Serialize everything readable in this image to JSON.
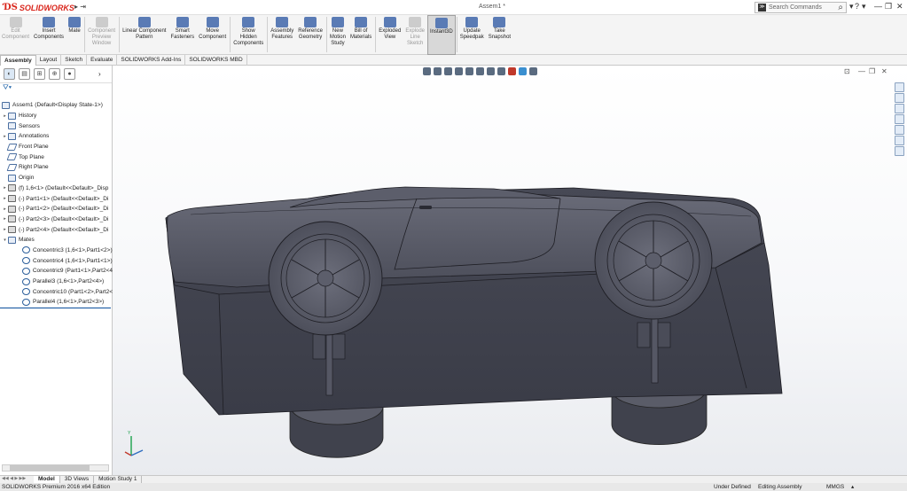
{
  "app": {
    "name": "SOLIDWORKS",
    "window_title": "Assem1 *"
  },
  "search": {
    "placeholder": "Search Commands"
  },
  "ribbon": {
    "buttons": [
      {
        "label": "Edit\nComponent",
        "disabled": true,
        "icon": "edit-component-icon"
      },
      {
        "label": "Insert\nComponents",
        "disabled": false,
        "icon": "insert-components-icon"
      },
      {
        "label": "Mate",
        "disabled": false,
        "icon": "mate-icon"
      },
      {
        "label": "Component\nPreview\nWindow",
        "disabled": true,
        "icon": "component-preview-icon"
      },
      {
        "label": "Linear Component\nPattern",
        "disabled": false,
        "icon": "linear-pattern-icon"
      },
      {
        "label": "Smart\nFasteners",
        "disabled": false,
        "icon": "smart-fasteners-icon"
      },
      {
        "label": "Move\nComponent",
        "disabled": false,
        "icon": "move-component-icon"
      },
      {
        "label": "Show\nHidden\nComponents",
        "disabled": false,
        "icon": "show-hidden-icon"
      },
      {
        "label": "Assembly\nFeatures",
        "disabled": false,
        "icon": "assembly-features-icon"
      },
      {
        "label": "Reference\nGeometry",
        "disabled": false,
        "icon": "reference-geometry-icon"
      },
      {
        "label": "New\nMotion\nStudy",
        "disabled": false,
        "icon": "motion-study-icon"
      },
      {
        "label": "Bill of\nMaterials",
        "disabled": false,
        "icon": "bill-of-materials-icon"
      },
      {
        "label": "Exploded\nView",
        "disabled": false,
        "icon": "exploded-view-icon"
      },
      {
        "label": "Explode\nLine\nSketch",
        "disabled": true,
        "icon": "explode-line-icon"
      },
      {
        "label": "Instant3D",
        "disabled": false,
        "active": true,
        "icon": "instant3d-icon"
      },
      {
        "label": "Update\nSpeedpak",
        "disabled": false,
        "icon": "speedpak-icon"
      },
      {
        "label": "Take\nSnapshot",
        "disabled": false,
        "icon": "snapshot-icon"
      }
    ]
  },
  "cm_tabs": [
    "Assembly",
    "Layout",
    "Sketch",
    "Evaluate",
    "SOLIDWORKS Add-Ins",
    "SOLIDWORKS MBD"
  ],
  "tree": {
    "items": [
      {
        "label": "Assem1  (Default<Display State-1>)",
        "level": 0,
        "icon": "assembly"
      },
      {
        "label": "History",
        "level": 1,
        "expand": "▸",
        "icon": "folder"
      },
      {
        "label": "Sensors",
        "level": 1,
        "icon": "folder"
      },
      {
        "label": "Annotations",
        "level": 1,
        "expand": "▸",
        "icon": "folder"
      },
      {
        "label": "Front Plane",
        "level": 1,
        "icon": "plane"
      },
      {
        "label": "Top Plane",
        "level": 1,
        "icon": "plane"
      },
      {
        "label": "Right Plane",
        "level": 1,
        "icon": "plane"
      },
      {
        "label": "Origin",
        "level": 1,
        "icon": "origin"
      },
      {
        "label": "(f) 1,6<1> (Default<<Default>_Disp",
        "level": 1,
        "expand": "▸",
        "icon": "part"
      },
      {
        "label": "(-) Part1<1> (Default<<Default>_Di",
        "level": 1,
        "expand": "▸",
        "icon": "part"
      },
      {
        "label": "(-) Part1<2> (Default<<Default>_Di",
        "level": 1,
        "expand": "▸",
        "icon": "part"
      },
      {
        "label": "(-) Part2<3> (Default<<Default>_Di",
        "level": 1,
        "expand": "▸",
        "icon": "part"
      },
      {
        "label": "(-) Part2<4> (Default<<Default>_Di",
        "level": 1,
        "expand": "▸",
        "icon": "part"
      },
      {
        "label": "Mates",
        "level": 1,
        "expand": "▾",
        "icon": "mates"
      },
      {
        "label": "Concentric3 (1,6<1>,Part1<2>)",
        "level": 2,
        "icon": "mate"
      },
      {
        "label": "Concentric4 (1,6<1>,Part1<1>)",
        "level": 2,
        "icon": "mate"
      },
      {
        "label": "Concentric9 (Part1<1>,Part2<4",
        "level": 2,
        "icon": "mate"
      },
      {
        "label": "Parallel3 (1,6<1>,Part2<4>)",
        "level": 2,
        "icon": "mate"
      },
      {
        "label": "Concentric10 (Part1<2>,Part2<",
        "level": 2,
        "icon": "mate"
      },
      {
        "label": "Parallel4 (1,6<1>,Part2<3>)",
        "level": 2,
        "icon": "mate"
      }
    ]
  },
  "bottom_tabs": [
    "Model",
    "3D Views",
    "Motion Study 1"
  ],
  "status": {
    "edition": "SOLIDWORKS Premium 2016 x64 Edition",
    "definition": "Under Defined",
    "mode": "Editing Assembly",
    "units": "MMGS"
  }
}
